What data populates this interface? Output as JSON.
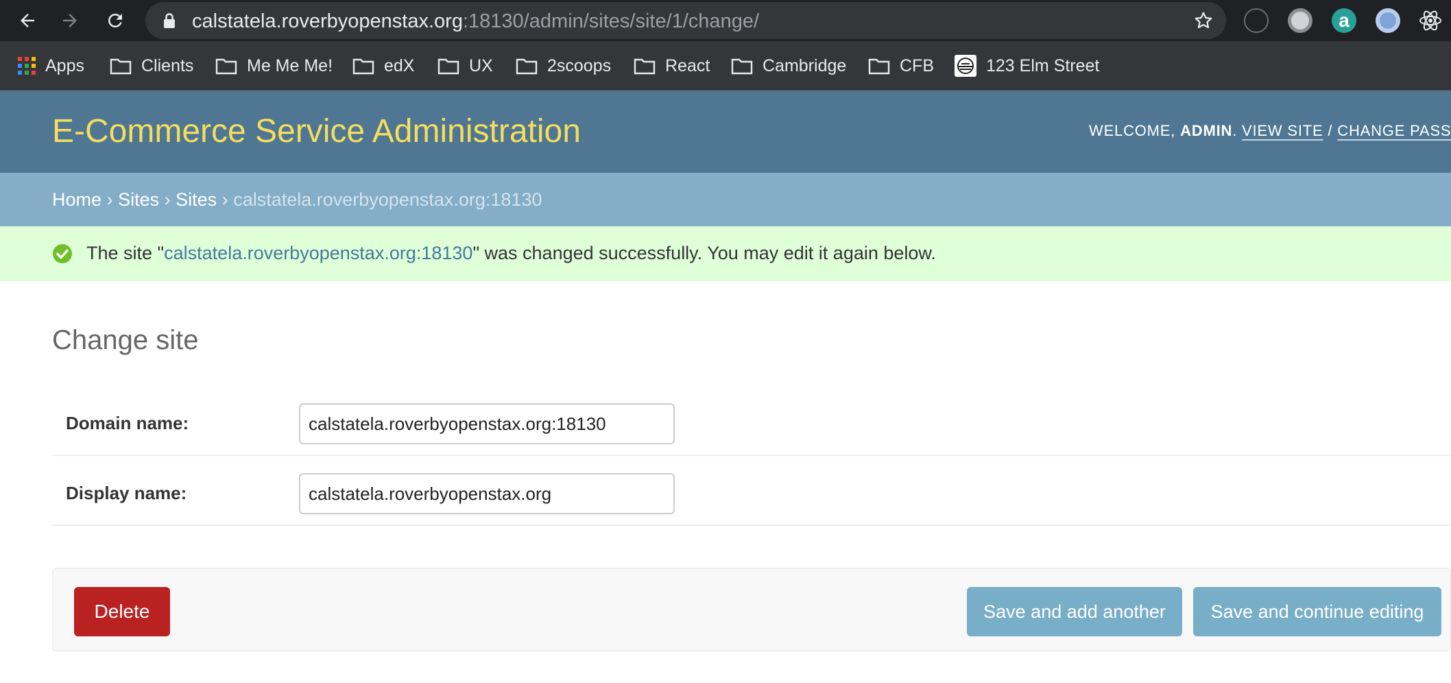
{
  "browser": {
    "url_host": "calstatela.roverbyopenstax.org",
    "url_path": ":18130/admin/sites/site/1/change/"
  },
  "bookmarks": [
    {
      "label": "Apps",
      "icon": "apps-grid-icon"
    },
    {
      "label": "Clients",
      "icon": "folder-icon"
    },
    {
      "label": "Me Me Me!",
      "icon": "folder-icon"
    },
    {
      "label": "edX",
      "icon": "folder-icon"
    },
    {
      "label": "UX",
      "icon": "folder-icon"
    },
    {
      "label": "2scoops",
      "icon": "folder-icon"
    },
    {
      "label": "React",
      "icon": "folder-icon"
    },
    {
      "label": "Cambridge",
      "icon": "folder-icon"
    },
    {
      "label": "CFB",
      "icon": "folder-icon"
    },
    {
      "label": "123 Elm Street",
      "icon": "site-favicon"
    }
  ],
  "header": {
    "branding": "E-Commerce Service Administration",
    "welcome": "WELCOME,",
    "user": "ADMIN",
    "view_site": "VIEW SITE",
    "separator": "/",
    "change_password": "CHANGE PASSWO"
  },
  "breadcrumbs": {
    "home": "Home",
    "app": "Sites",
    "model": "Sites",
    "current": "calstatela.roverbyopenstax.org:18130",
    "sep": "›"
  },
  "message": {
    "prefix": "The site \"",
    "link": "calstatela.roverbyopenstax.org:18130",
    "suffix": "\" was changed successfully. You may edit it again below."
  },
  "page": {
    "title": "Change site"
  },
  "form": {
    "domain_label": "Domain name:",
    "domain_value": "calstatela.roverbyopenstax.org:18130",
    "display_label": "Display name:",
    "display_value": "calstatela.roverbyopenstax.org"
  },
  "actions": {
    "delete": "Delete",
    "save_add_another": "Save and add another",
    "save_continue": "Save and continue editing"
  },
  "colors": {
    "header_bg": "#4f7793",
    "branding": "#f5dd5d",
    "breadcrumbs_bg": "#84adc7",
    "success_bg": "#dfffd9",
    "delete_bg": "#ba2121",
    "save_bg": "#79aec8"
  }
}
